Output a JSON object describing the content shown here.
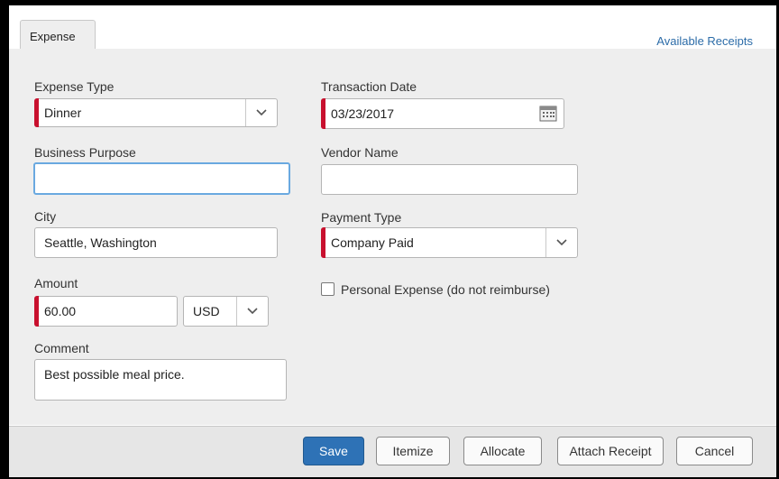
{
  "tabs": {
    "expense": "Expense"
  },
  "links": {
    "available_receipts": "Available Receipts"
  },
  "form": {
    "expense_type": {
      "label": "Expense Type",
      "value": "Dinner"
    },
    "business_purpose": {
      "label": "Business Purpose",
      "value": ""
    },
    "city": {
      "label": "City",
      "value": "Seattle, Washington"
    },
    "amount": {
      "label": "Amount",
      "value": "60.00",
      "currency": "USD"
    },
    "comment": {
      "label": "Comment",
      "value": "Best possible meal price."
    },
    "transaction_date": {
      "label": "Transaction Date",
      "value": "03/23/2017"
    },
    "vendor_name": {
      "label": "Vendor Name",
      "value": ""
    },
    "payment_type": {
      "label": "Payment Type",
      "value": "Company Paid"
    },
    "personal_expense": {
      "label": "Personal Expense (do not reimburse)",
      "checked": false
    }
  },
  "buttons": {
    "save": "Save",
    "itemize": "Itemize",
    "allocate": "Allocate",
    "attach_receipt": "Attach Receipt",
    "cancel": "Cancel"
  },
  "colors": {
    "required": "#c8102e",
    "primary": "#2e72b6",
    "link": "#2c6ca8"
  }
}
